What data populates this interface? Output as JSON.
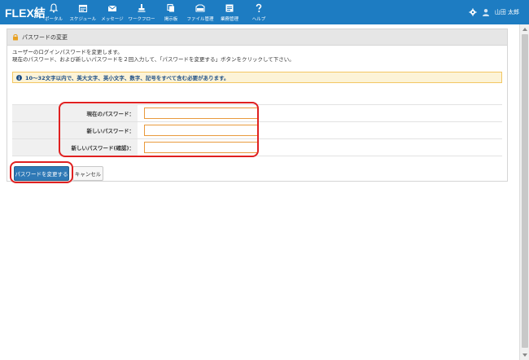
{
  "app": {
    "logo": "FLEX結"
  },
  "nav": [
    {
      "label": "ポータル",
      "icon": "bell-icon"
    },
    {
      "label": "スケジュール",
      "icon": "calendar-icon"
    },
    {
      "label": "メッセージ",
      "icon": "envelope-icon"
    },
    {
      "label": "ワークフロー",
      "icon": "stamp-icon"
    },
    {
      "label": "掲示板",
      "icon": "board-icon"
    },
    {
      "label": "ファイル管理",
      "icon": "folder-icon"
    },
    {
      "label": "業務管理",
      "icon": "calendar-grid-icon"
    },
    {
      "label": "ヘルプ",
      "icon": "question-icon"
    }
  ],
  "header": {
    "username": "山田 太郎",
    "settings_icon": "gear-icon",
    "user_icon": "user-icon"
  },
  "panel": {
    "title": "パスワードの変更",
    "desc_line1": "ユーザーのログインパスワードを変更します。",
    "desc_line2": "現在のパスワード、および新しいパスワードを２回入力して、「パスワードを変更する」ボタンをクリックして下さい。",
    "notice": "10～32文字以内で、英大文字、英小文字、数字、記号をすべて含む必要があります。"
  },
  "form": {
    "current_label": "現在のパスワード：",
    "new_label": "新しいパスワード：",
    "confirm_label": "新しいパスワード(確認)：",
    "current_value": "",
    "new_value": "",
    "confirm_value": ""
  },
  "buttons": {
    "change": "パスワードを変更する",
    "cancel": "キャンセル"
  },
  "colors": {
    "header": "#1d7cc2",
    "highlight": "#e02020",
    "notice_bg": "#fcf3d7",
    "input_border": "#e99a3d"
  }
}
